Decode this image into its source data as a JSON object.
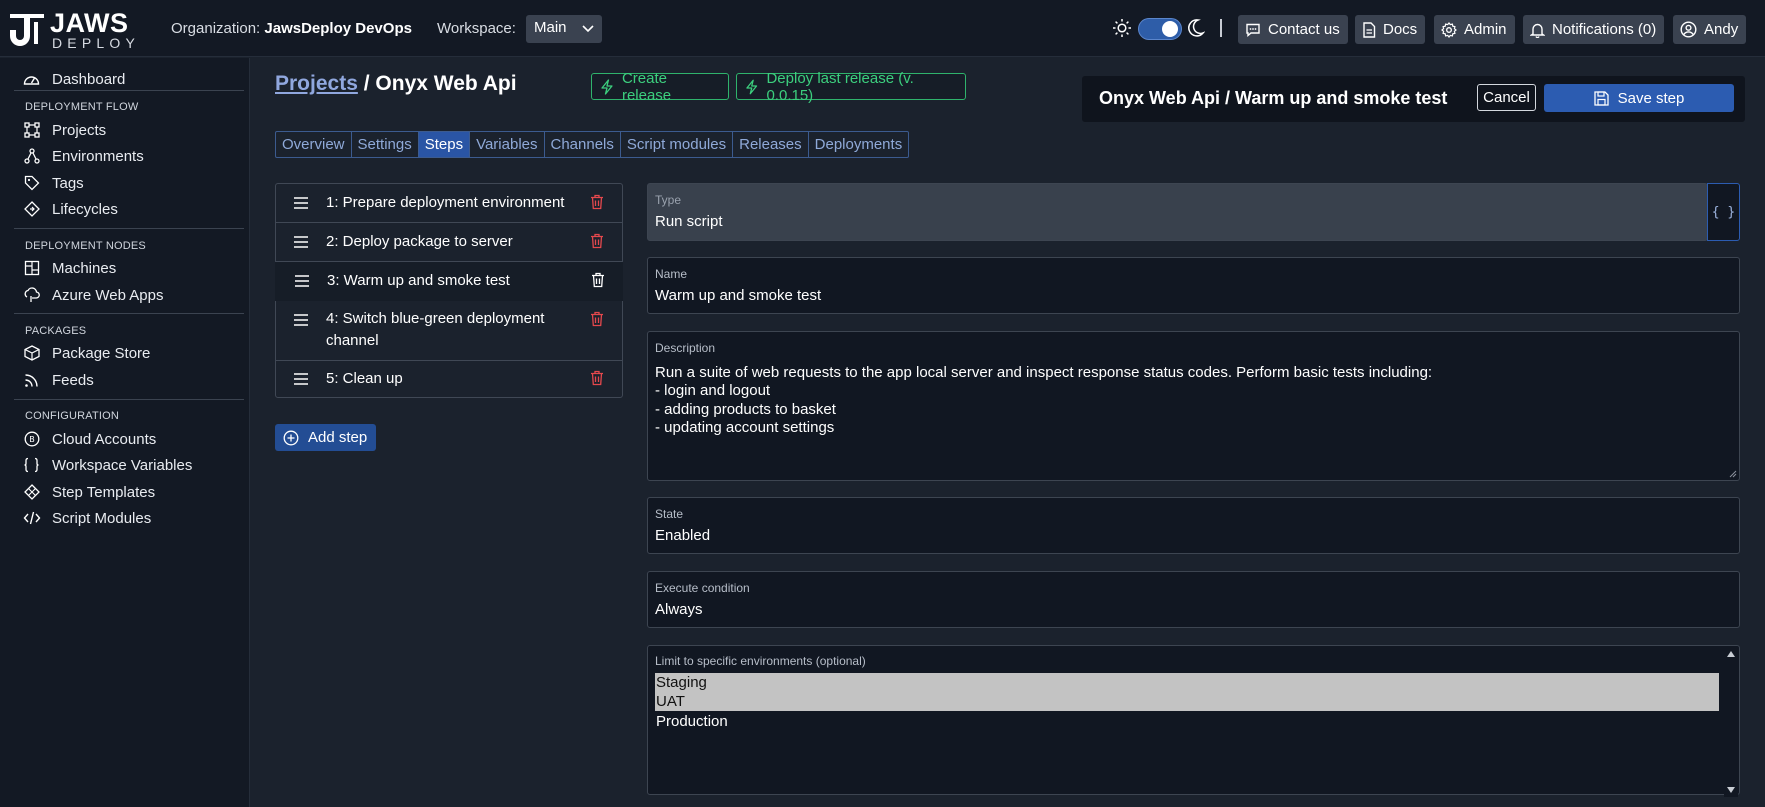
{
  "brand": {
    "name_top": "JAWS",
    "name_bottom": "DEPLOY"
  },
  "topbar": {
    "org_label": "Organization:",
    "org_name": "JawsDeploy DevOps",
    "workspace_label": "Workspace:",
    "workspace_value": "Main",
    "contact": "Contact us",
    "docs": "Docs",
    "admin": "Admin",
    "notifications": "Notifications (0)",
    "user": "Andy"
  },
  "sidebar": {
    "dashboard": "Dashboard",
    "sections": [
      {
        "title": "DEPLOYMENT FLOW",
        "items": [
          "Projects",
          "Environments",
          "Tags",
          "Lifecycles"
        ]
      },
      {
        "title": "DEPLOYMENT NODES",
        "items": [
          "Machines",
          "Azure Web Apps"
        ]
      },
      {
        "title": "PACKAGES",
        "items": [
          "Package Store",
          "Feeds"
        ]
      },
      {
        "title": "CONFIGURATION",
        "items": [
          "Cloud Accounts",
          "Workspace Variables",
          "Step Templates",
          "Script Modules"
        ]
      }
    ]
  },
  "breadcrumb": {
    "projects": "Projects",
    "separator": "/",
    "project": "Onyx Web Api"
  },
  "actions": {
    "create_release": "Create release",
    "deploy_last": "Deploy last release (v. 0.0.15)"
  },
  "tabs": [
    "Overview",
    "Settings",
    "Steps",
    "Variables",
    "Channels",
    "Script modules",
    "Releases",
    "Deployments"
  ],
  "active_tab": "Steps",
  "steps": [
    {
      "label": "1: Prepare deployment environment"
    },
    {
      "label": "2: Deploy package to server"
    },
    {
      "label": "3: Warm up and smoke test"
    },
    {
      "label_line1": "4: Switch blue-green deployment",
      "label_line2": "channel"
    },
    {
      "label": "5: Clean up"
    }
  ],
  "add_step": "Add step",
  "editor": {
    "title": "Onyx Web Api / Warm up and smoke test",
    "cancel": "Cancel",
    "save": "Save step",
    "type_label": "Type",
    "type_value": "Run script",
    "brace": "{ }",
    "name_label": "Name",
    "name_value": "Warm up and smoke test",
    "description_label": "Description",
    "description_value": "Run a suite of web requests to the app local server and inspect response status codes. Perform basic tests including:\n- login and logout\n- adding products to basket\n- updating account settings",
    "state_label": "State",
    "state_value": "Enabled",
    "condition_label": "Execute condition",
    "condition_value": "Always",
    "env_label": "Limit to specific environments (optional)",
    "environments": [
      "Staging",
      "UAT",
      "Production"
    ]
  },
  "colors": {
    "accent": "#2c5cb1",
    "success": "#3ccf7e",
    "danger": "#e5484d",
    "bg": "#1b222d",
    "panel": "#131924"
  }
}
